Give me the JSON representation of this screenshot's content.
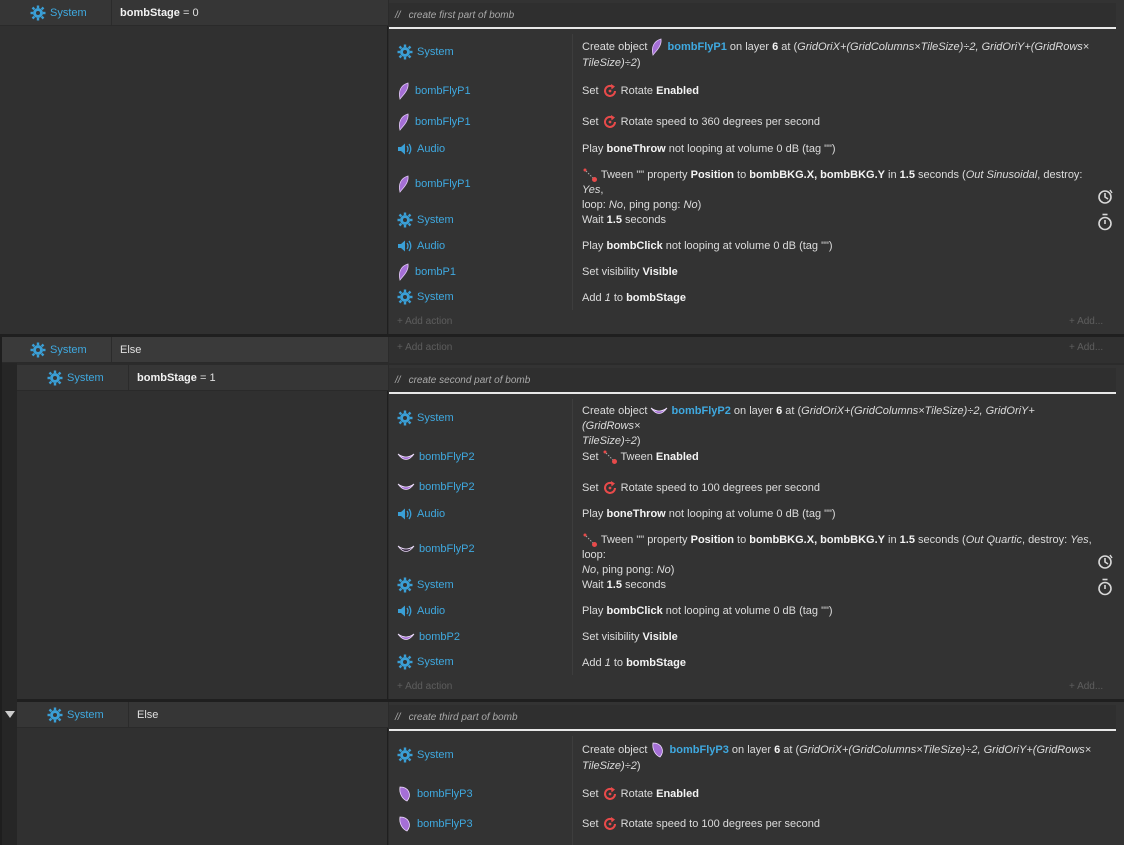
{
  "colors": {
    "accent": "#3fa9e0",
    "rotate": "#e84a4a",
    "feather": "#a56fd6"
  },
  "events": [
    {
      "condition": {
        "object": "System",
        "variable": "bombStage",
        "op": " = 0"
      },
      "comment": "create first part of bomb",
      "actions": [
        {
          "object": "System",
          "icon": "gear-icon",
          "parts": [
            "Create object ",
            "",
            "bombFlyP1",
            " on layer ",
            "6",
            " at (",
            "GridOriX+(GridColumns×TileSize)÷2, GridOriY+(GridRows×",
            "TileSize)÷2",
            ")"
          ]
        },
        {
          "object": "bombFlyP1",
          "icon": "feather-icon",
          "prefix": "Set ",
          "label": "Rotate",
          "value": "Enabled"
        },
        {
          "object": "bombFlyP1",
          "icon": "feather-icon",
          "prefix": "Set ",
          "label": "Rotate speed to 360 degrees per second"
        },
        {
          "object": "Audio",
          "icon": "speaker-icon",
          "text1": "Play ",
          "bold1": "boneThrow",
          "text2": " not looping at volume 0 dB (tag \"\")"
        },
        {
          "object": "bombFlyP1",
          "icon": "feather-icon",
          "tween": [
            "Tween \"\" property ",
            "Position",
            " to ",
            "bombBKG.X, bombBKG.Y",
            " in ",
            "1.5",
            " seconds (",
            "Out Sinusoidal",
            ", destroy: ",
            "Yes",
            ",",
            "loop: ",
            "No",
            ", ping pong: ",
            "No",
            ")"
          ]
        },
        {
          "object": "System",
          "icon": "gear-icon",
          "text1": "Wait ",
          "bold1": "1.5",
          "text2": " seconds"
        },
        {
          "object": "Audio",
          "icon": "speaker-icon",
          "text1": "Play ",
          "bold1": "bombClick",
          "text2": " not looping at volume 0 dB (tag \"\")"
        },
        {
          "object": "bombP1",
          "icon": "feather-icon",
          "text1": "Set visibility ",
          "bold1": "Visible",
          "text2": ""
        },
        {
          "object": "System",
          "icon": "gear-icon",
          "text1": "Add ",
          "ital": "1",
          "text2": " to ",
          "bold1": "bombStage"
        }
      ]
    },
    {
      "condition": {
        "object": "System",
        "else": "Else"
      }
    },
    {
      "condition": {
        "object": "System",
        "variable": "bombStage",
        "op": " = 1"
      },
      "comment": "create second part of bomb",
      "actions": [
        {
          "object": "System",
          "icon": "gear-icon",
          "parts": [
            "Create object ",
            "",
            "bombFlyP2",
            " on layer ",
            "6",
            " at (",
            "GridOriX+(GridColumns×TileSize)÷2, GridOriY+(GridRows×",
            "TileSize)÷2",
            ")"
          ]
        },
        {
          "object": "bombFlyP2",
          "icon": "bowl-icon",
          "prefix": "Set ",
          "label": "Tween",
          "value": "Enabled"
        },
        {
          "object": "bombFlyP2",
          "icon": "bowl-icon",
          "prefix": "Set ",
          "label": "Rotate speed to 100 degrees per second"
        },
        {
          "object": "Audio",
          "icon": "speaker-icon",
          "text1": "Play ",
          "bold1": "boneThrow",
          "text2": " not looping at volume 0 dB (tag \"\")"
        },
        {
          "object": "bombFlyP2",
          "icon": "bowl-icon",
          "tween": [
            "Tween \"\" property ",
            "Position",
            " to ",
            "bombBKG.X, bombBKG.Y",
            " in ",
            "1.5",
            " seconds (",
            "Out Quartic",
            ", destroy: ",
            "Yes",
            ", loop:",
            "",
            "No",
            ", ping pong: ",
            "No",
            ")"
          ]
        },
        {
          "object": "System",
          "icon": "gear-icon",
          "text1": "Wait ",
          "bold1": "1.5",
          "text2": " seconds"
        },
        {
          "object": "Audio",
          "icon": "speaker-icon",
          "text1": "Play ",
          "bold1": "bombClick",
          "text2": " not looping at volume 0 dB (tag \"\")"
        },
        {
          "object": "bombP2",
          "icon": "bowl-icon",
          "text1": "Set visibility ",
          "bold1": "Visible",
          "text2": ""
        },
        {
          "object": "System",
          "icon": "gear-icon",
          "text1": "Add ",
          "ital": "1",
          "text2": " to ",
          "bold1": "bombStage"
        }
      ]
    },
    {
      "condition": {
        "object": "System",
        "else": "Else"
      },
      "comment": "create third part of bomb",
      "actions": [
        {
          "object": "System",
          "icon": "gear-icon",
          "parts": [
            "Create object ",
            "",
            "bombFlyP3",
            " on layer ",
            "6",
            " at (",
            "GridOriX+(GridColumns×TileSize)÷2, GridOriY+(GridRows×",
            "TileSize)÷2",
            ")"
          ]
        },
        {
          "object": "bombFlyP3",
          "icon": "leaf-icon",
          "prefix": "Set ",
          "label": "Rotate",
          "value": "Enabled"
        },
        {
          "object": "bombFlyP3",
          "icon": "leaf-icon",
          "prefix": "Set ",
          "label": "Rotate speed to 100 degrees per second"
        }
      ]
    }
  ],
  "add_action": "+ Add action",
  "add_short": "+ Add..."
}
